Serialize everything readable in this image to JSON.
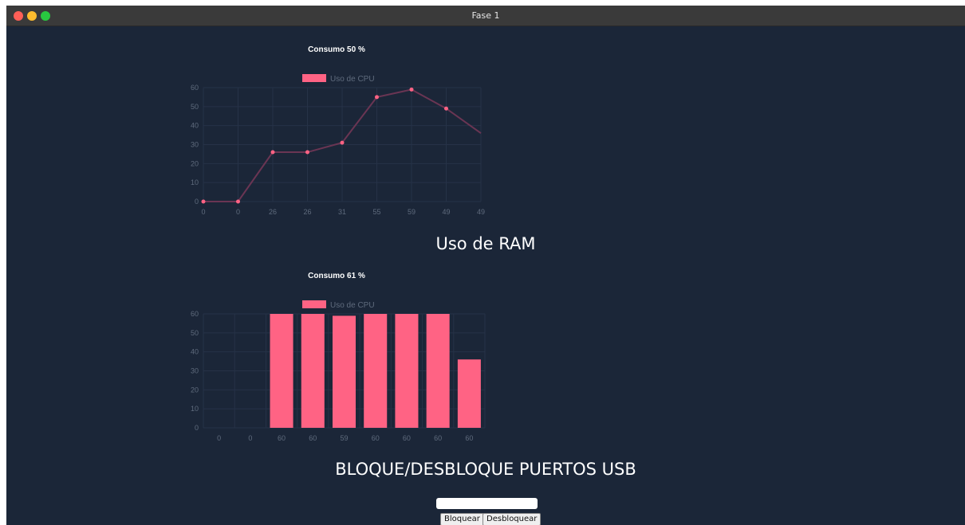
{
  "window": {
    "title": "Fase 1"
  },
  "cpu_chart": {
    "title": "Consumo 50 %",
    "legend": "Uso de CPU",
    "color": "#ff6384"
  },
  "ram_section": {
    "heading": "Uso de RAM"
  },
  "ram_chart": {
    "title": "Consumo 61 %",
    "legend": "Uso de CPU",
    "color": "#ff6384"
  },
  "usb_section": {
    "heading": "BLOQUE/DESBLOQUE PUERTOS USB",
    "input_value": "",
    "block_label": "Bloquear",
    "unblock_label": "Desbloquear"
  },
  "chart_data": [
    {
      "type": "line",
      "title": "Consumo 50 %",
      "categories": [
        "0",
        "0",
        "26",
        "26",
        "31",
        "55",
        "59",
        "49",
        "49"
      ],
      "series": [
        {
          "name": "Uso de CPU",
          "values": [
            0,
            0,
            26,
            26,
            31,
            55,
            59,
            49,
            36
          ]
        }
      ],
      "ylim": [
        0,
        60
      ],
      "yticks": [
        0,
        10,
        20,
        30,
        40,
        50,
        60
      ],
      "grid": true,
      "legend": "top"
    },
    {
      "type": "bar",
      "title": "Consumo 61 %",
      "categories": [
        "0",
        "0",
        "60",
        "60",
        "59",
        "60",
        "60",
        "60",
        "60"
      ],
      "series": [
        {
          "name": "Uso de CPU",
          "values": [
            0,
            0,
            60,
            60,
            59,
            60,
            60,
            60,
            36
          ]
        }
      ],
      "ylim": [
        0,
        60
      ],
      "yticks": [
        0,
        10,
        20,
        30,
        40,
        50,
        60
      ],
      "grid": true,
      "legend": "top"
    }
  ]
}
